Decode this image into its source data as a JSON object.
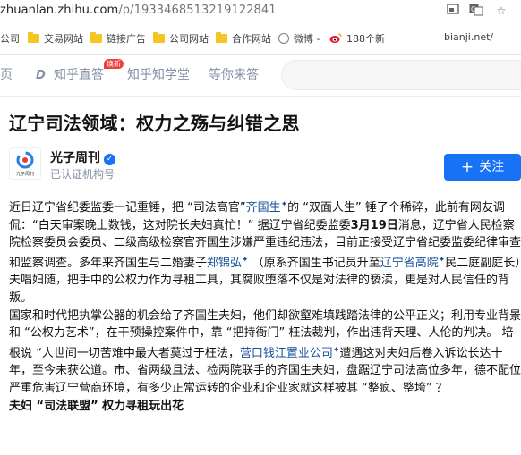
{
  "address_bar": {
    "host": "zhuanlan.zhihu.com",
    "path": "/p/1933468513219122841"
  },
  "bookmarks": [
    {
      "label": "公司",
      "icon": "none"
    },
    {
      "label": "交易网站",
      "icon": "folder-icon"
    },
    {
      "label": "链接广告",
      "icon": "folder-icon"
    },
    {
      "label": "公司网站",
      "icon": "folder-icon"
    },
    {
      "label": "合作网站",
      "icon": "folder-icon"
    },
    {
      "label": "微博 -",
      "icon": "globe-icon"
    },
    {
      "label": "188个新",
      "icon": "weibo-icon"
    },
    {
      "label": "bianji.net/",
      "icon": "none"
    }
  ],
  "nav": {
    "home": "首页",
    "zhihu_zhida": "知乎直答",
    "badge": "焕新",
    "learn": "知乎知学堂",
    "answer": "等你来答"
  },
  "article": {
    "title": "辽宁司法领域：权力之殇与纠错之思",
    "author": "光子周刊",
    "author_sub": "已认证机构号",
    "logo_text": "光子周刊",
    "follow_label": "关注"
  },
  "body": {
    "p1_a": "近日辽宁省纪委监委一记重锤，把 “司法高官”",
    "p1_link1": "齐国生",
    "p1_b": "的 “双面人生” 锤了个稀碎，此前有网友调侃：“白天审案晚上数钱，这对院长夫妇真忙！” 据辽宁省纪委监委",
    "p1_date": "3月19日",
    "p1_c": "消息，辽宁省人民检察院检察委员会委员、二级高级检察官齐国生涉嫌严重违纪违法，目前正接受辽宁省纪委监委纪律审查和监察调查。多年来齐国生与二婚妻子",
    "p1_link2": "郑锦弘",
    "p1_d": " （原系齐国生书记员升至",
    "p1_link3": "辽宁省高院",
    "p1_e": "民二庭副庭长）夫唱妇随，把手中的公权力作为寻租工具，其腐败堕落不仅是对法律的亵渎，更是对人民信任的背叛。",
    "p2_a": "国家和时代把执掌公器的机会给了齐国生夫妇，他们却欲壑难填践踏法律的公平正义；利用专业背景和 “公权力艺术”，在干预操控案件中，靠 “把持衙门” 枉法裁判，作出违背天理、人伦的判决。 培根说 “人世间一切苦难中最大者莫过于枉法，",
    "p2_link": "营口钱江置业公司",
    "p2_b": "遭遇这对夫妇后卷入诉讼长达十年，至今未获公道。市、省两级且法、检两院联手的齐国生夫妇，盘踞辽宁司法高位多年，德不配位严重危害辽宁营商环境，有多少正常运转的企业和企业家就这样被其 “整疯、整垮” ？",
    "subheading": "夫妇 “司法联盟” 权力寻租玩出花"
  }
}
